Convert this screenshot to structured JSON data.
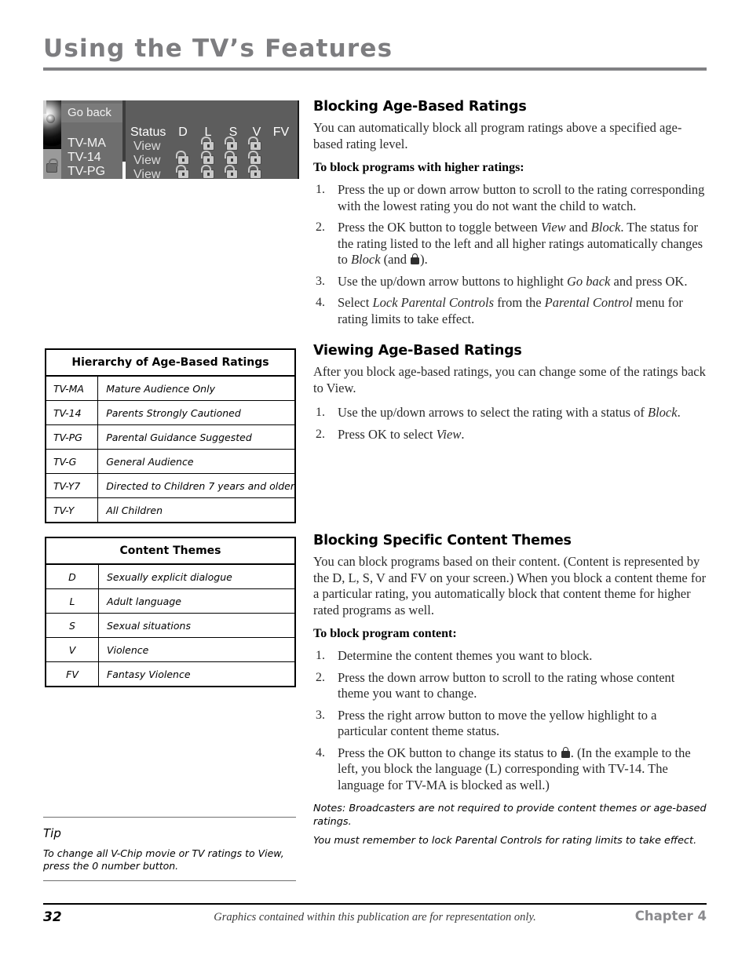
{
  "header": {
    "title": "Using the TV’s Features"
  },
  "tv_screen": {
    "go_back_label": "Go back",
    "ratings": [
      "TV-MA",
      "TV-14",
      "TV-PG"
    ],
    "status_header": "Status",
    "theme_columns": [
      "D",
      "L",
      "S",
      "V",
      "FV"
    ],
    "statuses": [
      "View",
      "View",
      "View"
    ],
    "lock_grid": [
      [
        false,
        true,
        true,
        true,
        false
      ],
      [
        true,
        true,
        true,
        true,
        false
      ],
      [
        true,
        true,
        true,
        true,
        false
      ]
    ]
  },
  "table_hierarchy": {
    "title": "Hierarchy of Age-Based Ratings",
    "rows": [
      {
        "code": "TV-MA",
        "desc": "Mature Audience Only"
      },
      {
        "code": "TV-14",
        "desc": "Parents Strongly Cautioned"
      },
      {
        "code": "TV-PG",
        "desc": "Parental Guidance Suggested"
      },
      {
        "code": "TV-G",
        "desc": "General Audience"
      },
      {
        "code": "TV-Y7",
        "desc": "Directed to Children 7 years and older"
      },
      {
        "code": "TV-Y",
        "desc": "All Children"
      }
    ]
  },
  "table_content_themes": {
    "title": "Content Themes",
    "rows": [
      {
        "code": "D",
        "desc": "Sexually explicit dialogue"
      },
      {
        "code": "L",
        "desc": "Adult language"
      },
      {
        "code": "S",
        "desc": "Sexual situations"
      },
      {
        "code": "V",
        "desc": "Violence"
      },
      {
        "code": "FV",
        "desc": "Fantasy Violence"
      }
    ]
  },
  "tip": {
    "heading": "Tip",
    "text": "To change all V-Chip movie or TV ratings to View, press the 0 number button."
  },
  "section_blocking_age": {
    "heading": "Blocking Age-Based Ratings",
    "intro": "You can automatically block all program ratings above a specified age-based rating level.",
    "run_in": "To block programs with higher ratings:",
    "steps": [
      {
        "num": "1.",
        "text": "Press the up or down arrow button to scroll to the rating corresponding with the lowest rating you do not want the child to watch."
      },
      {
        "num": "2.",
        "text": "Press the OK button to toggle between View and Block. The status for the rating listed to the left and all higher ratings automatically changes to Block (and 🔒)."
      },
      {
        "num": "3.",
        "text": "Use the up/down arrow buttons to highlight Go back and press OK."
      },
      {
        "num": "4.",
        "text": "Select Lock Parental Controls from the Parental Control menu for rating limits to take effect."
      }
    ]
  },
  "section_viewing_age": {
    "heading": "Viewing Age-Based Ratings",
    "intro": "After you block age-based ratings, you can change some of the ratings back to View.",
    "steps": [
      {
        "num": "1.",
        "text": "Use the up/down arrows to select the rating with a status of Block."
      },
      {
        "num": "2.",
        "text": "Press OK to select View."
      }
    ]
  },
  "section_content_themes": {
    "heading": "Blocking Specific Content Themes",
    "intro": "You can block programs based on their content. (Content is represented by the D, L, S, V and FV on your screen.) When you block a content theme for a particular rating, you automatically block that content theme for higher rated programs as well.",
    "run_in": "To block program content:",
    "steps": [
      {
        "num": "1.",
        "text": "Determine the content themes you want to block."
      },
      {
        "num": "2.",
        "text": "Press the down arrow button to scroll to the rating whose content theme you want to change."
      },
      {
        "num": "3.",
        "text": "Press the right arrow button to move the yellow highlight to a particular content theme status."
      },
      {
        "num": "4.",
        "text": "Press the OK button to change its status to 🔒. (In the example to the left, you block the language (L) corresponding with TV-14. The language for TV-MA is blocked as well.)"
      }
    ],
    "notes": [
      "Notes: Broadcasters are not required to provide content themes or age-based ratings.",
      "You must remember to lock Parental Controls for rating limits to take effect."
    ]
  },
  "footer": {
    "page_number": "32",
    "center_text": "Graphics contained within this publication are for representation only.",
    "chapter": "Chapter 4"
  }
}
